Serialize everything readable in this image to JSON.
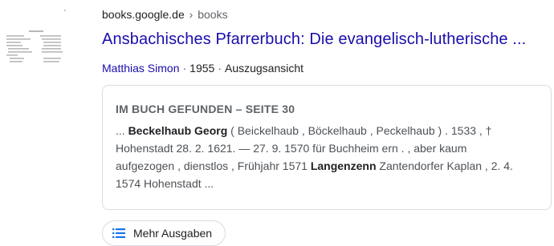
{
  "result": {
    "url_domain": "books.google.de",
    "url_separator": "›",
    "url_path": "books",
    "title": "Ansbachisches Pfarrerbuch: Die evangelisch-lutherische ...",
    "author": "Matthias Simon",
    "year": "1955",
    "view_type": "Auszugsansicht",
    "meta_sep": "·"
  },
  "card": {
    "heading": "IM BUCH GEFUNDEN – SEITE 30",
    "line1_a": "... ",
    "line1_b": "Beckelhaub Georg",
    "line1_c": " ( Beickelhaub , Böckelhaub , Peckelhaub ) . 1533 , †",
    "line2": "Hohenstadt 28. 2. 1621. — 27. 9. 1570 für Buchheim ern . , aber kaum",
    "line3_a": "aufgezogen , dienstlos , Frühjahr 1571 ",
    "line3_b": "Langenzenn",
    "line3_c": " Zantendorfer Kaplan , 2. 4.",
    "line4": "1574 Hohenstadt ..."
  },
  "more_button": {
    "label": "Mehr Ausgaben",
    "icon": "list-icon"
  },
  "thumbnail": {
    "icon": "book-page-thumbnail"
  },
  "colors": {
    "link": "#1a0dab",
    "text": "#202124",
    "muted": "#5f6368",
    "border": "#dadce0",
    "icon_blue": "#1a73e8"
  }
}
